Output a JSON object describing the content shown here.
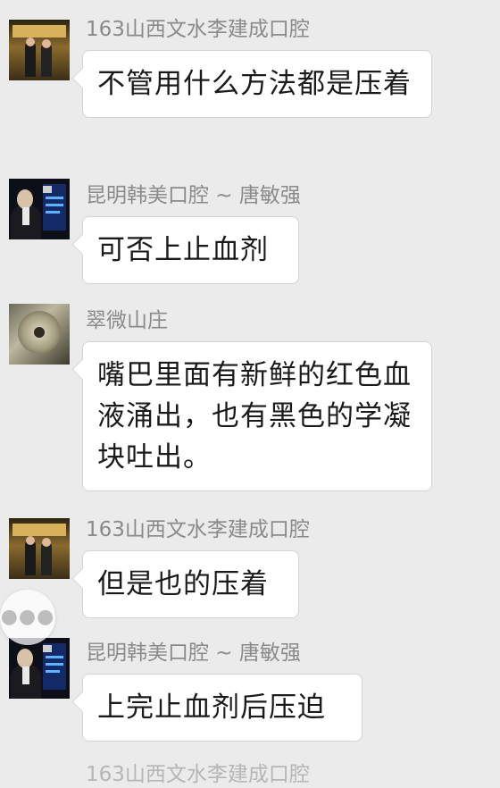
{
  "messages": [
    {
      "sender": "163山西文水李建成口腔",
      "text": "不管用什么方法都是压着",
      "avatar": "group-photo-avatar"
    },
    {
      "sender": "昆明韩美口腔 ~ 唐敏强",
      "text": "可否上止血剂",
      "avatar": "suited-man-avatar"
    },
    {
      "sender": "翠微山庄",
      "text": "嘴巴里面有新鲜的红色血液涌出，也有黑色的学凝块吐出。",
      "avatar": "vault-dial-avatar"
    },
    {
      "sender": "163山西文水李建成口腔",
      "text": "但是也的压着",
      "avatar": "group-photo-avatar"
    },
    {
      "sender": "昆明韩美口腔 ~ 唐敏强",
      "text": "上完止血剂后压迫",
      "avatar": "suited-man-avatar"
    },
    {
      "sender": "163山西文水李建成口腔",
      "text": "",
      "avatar": "group-photo-avatar"
    }
  ],
  "floating_button": {
    "label": "●●●"
  },
  "colors": {
    "background": "#ebebeb",
    "bubble": "#ffffff",
    "sender_name": "#8a8a8a"
  }
}
